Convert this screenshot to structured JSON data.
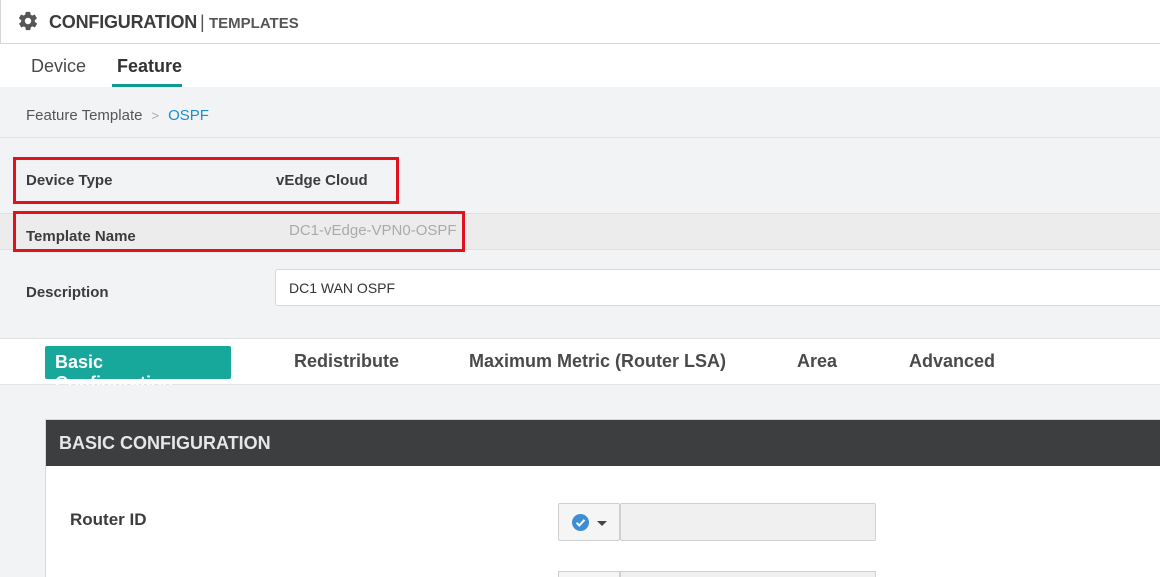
{
  "header": {
    "title": "CONFIGURATION",
    "separator": "|",
    "subtitle": "TEMPLATES",
    "icon": "gear-icon"
  },
  "tabs": [
    {
      "label": "Device",
      "active": false
    },
    {
      "label": "Feature",
      "active": true
    }
  ],
  "breadcrumb": {
    "parent": "Feature Template",
    "separator": ">",
    "current": "OSPF"
  },
  "form": {
    "device_type_label": "Device Type",
    "device_type_value": "vEdge Cloud",
    "template_name_label": "Template Name",
    "template_name_value": "DC1-vEdge-VPN0-OSPF",
    "description_label": "Description",
    "description_value": "DC1 WAN OSPF"
  },
  "subtabs": [
    {
      "label": "Basic Configuration",
      "active": true
    },
    {
      "label": "Redistribute",
      "active": false
    },
    {
      "label": "Maximum Metric (Router LSA)",
      "active": false
    },
    {
      "label": "Area",
      "active": false
    },
    {
      "label": "Advanced",
      "active": false
    }
  ],
  "section": {
    "title": "BASIC CONFIGURATION",
    "router_id_label": "Router ID",
    "router_id_value": ""
  },
  "colors": {
    "accent": "#17a79b",
    "highlight_box": "#e3101e",
    "link": "#1a8ed1",
    "section_header": "#3d3e40"
  }
}
